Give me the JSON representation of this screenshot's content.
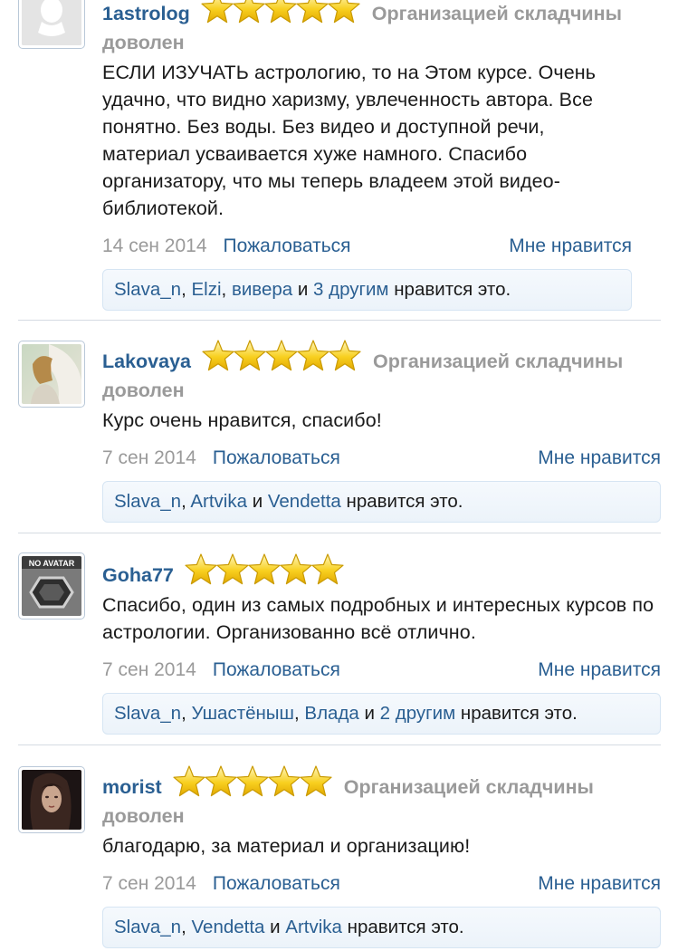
{
  "reviews": [
    {
      "username": "1astrolog",
      "rating": 5,
      "verdict": "Организацией складчины доволен",
      "message": "ЕСЛИ ИЗУЧАТЬ астрологию, то на Этом курсе. Очень удачно, что видно харизму, увлеченность автора. Все понятно. Без воды. Без видео и доступной речи, материал усваивается хуже намного. Спасибо организатору, что мы теперь владеем этой видео-библиотекой.",
      "date": "14 сен 2014",
      "report_label": "Пожаловаться",
      "like_label": "Мне нравится",
      "likers": [
        "Slava_n",
        "Elzi",
        "вивера"
      ],
      "likers_sep": ", ",
      "likers_and": " и ",
      "likers_extra": "3 другим",
      "likes_suffix": " нравится это.",
      "avatar": "default-silhouette"
    },
    {
      "username": "Lakovaya",
      "rating": 5,
      "verdict": "Организацией складчины доволен",
      "message": "Курс очень нравится, спасибо!",
      "date": "7 сен 2014",
      "report_label": "Пожаловаться",
      "like_label": "Мне нравится",
      "likers": [
        "Slava_n",
        "Artvika",
        "Vendetta"
      ],
      "likers_sep": ", ",
      "likers_and": " и ",
      "likers_extra": "",
      "likes_suffix": " нравится это.",
      "avatar": "photo-woman-horse"
    },
    {
      "username": "Goha77",
      "rating": 5,
      "verdict": "",
      "message": "Спасибо, один из самых подробных и интересных курсов по астрологии. Организованно всё отлично.",
      "date": "7 сен 2014",
      "report_label": "Пожаловаться",
      "like_label": "Мне нравится",
      "likers": [
        "Slava_n",
        "Ушастёныш",
        "Влада"
      ],
      "likers_sep": ", ",
      "likers_and": " и ",
      "likers_extra": "2 другим",
      "likes_suffix": " нравится это.",
      "avatar": "no-avatar",
      "avatar_text": "NO AVATAR"
    },
    {
      "username": "morist",
      "rating": 5,
      "verdict": "Организацией складчины доволен",
      "message": "благодарю, за материал и организацию!",
      "date": "7 сен 2014",
      "report_label": "Пожаловаться",
      "like_label": "Мне нравится",
      "likers": [
        "Slava_n",
        "Vendetta",
        "Artvika"
      ],
      "likers_sep": ", ",
      "likers_and": " и ",
      "likers_extra": "",
      "likes_suffix": " нравится это.",
      "avatar": "photo-dark-portrait"
    }
  ],
  "colors": {
    "link": "#2a5f92",
    "muted": "#9a9a9a",
    "star_fill": "#f5c400",
    "likes_bg": "#eef4fa",
    "likes_border": "#d6e5f3"
  }
}
